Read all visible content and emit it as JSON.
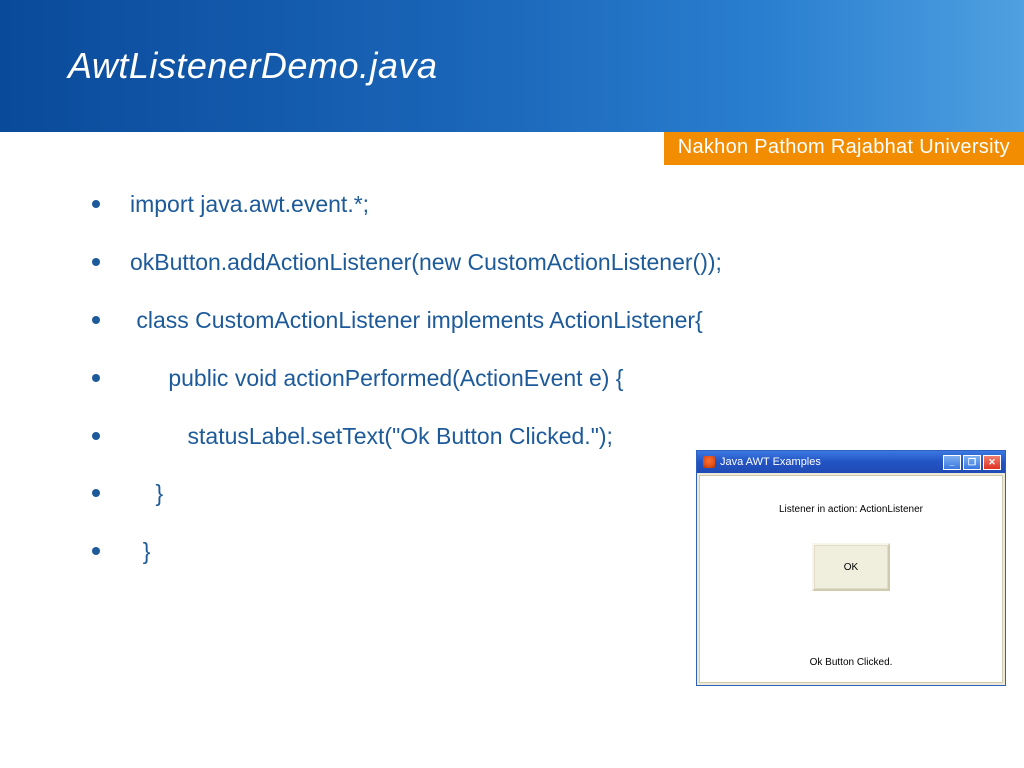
{
  "header": {
    "title": "AwtListenerDemo.java"
  },
  "badge": {
    "text": "Nakhon Pathom Rajabhat University"
  },
  "bullets": [
    "import java.awt.event.*;",
    "okButton.addActionListener(new CustomActionListener());",
    " class CustomActionListener implements ActionListener{",
    "      public void actionPerformed(ActionEvent e) {",
    "         statusLabel.setText(\"Ok Button Clicked.\");",
    "    }",
    "  }"
  ],
  "awt": {
    "title": "Java AWT Examples",
    "label1": "Listener in action: ActionListener",
    "button": "OK",
    "label2": "Ok Button Clicked."
  }
}
